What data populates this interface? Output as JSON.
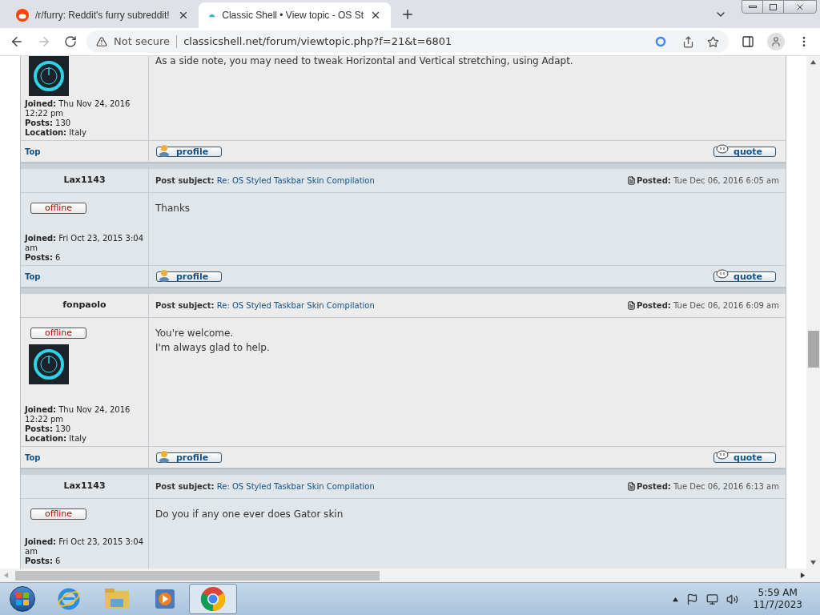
{
  "browser": {
    "tabs": [
      {
        "title": "/r/furry: Reddit's furry subreddit!",
        "selected": false
      },
      {
        "title": "Classic Shell • View topic - OS St",
        "selected": true
      }
    ],
    "security": "Not secure",
    "url": "classicshell.net/forum/viewtopic.php?f=21&t=6801"
  },
  "posts": [
    {
      "color": "#ececec",
      "avatar": true,
      "body": [
        "As a side note, you may need to tweak Horizontal and Vertical stretching, using Adapt."
      ],
      "profile": [
        {
          "label": "Joined:",
          "value": "Thu Nov 24, 2016 12:22 pm"
        },
        {
          "label": "Posts:",
          "value": "130"
        },
        {
          "label": "Location:",
          "value": "Italy"
        }
      ],
      "top": "Top",
      "profile_button": "profile",
      "quote_button": "quote"
    },
    {
      "color": "#e1e6ea",
      "author": "Lax1143",
      "subject_label": "Post subject:",
      "subject": "Re: OS Styled Taskbar Skin Compilation",
      "posted_label": "Posted:",
      "posted": "Tue Dec 06, 2016 6:05 am",
      "status": "offline",
      "avatar": false,
      "body": [
        "Thanks"
      ],
      "profile": [
        {
          "label": "Joined:",
          "value": "Fri Oct 23, 2015 3:04 am"
        },
        {
          "label": "Posts:",
          "value": "6"
        }
      ],
      "top": "Top",
      "profile_button": "profile",
      "quote_button": "quote"
    },
    {
      "color": "#ececec",
      "author": "fonpaolo",
      "subject_label": "Post subject:",
      "subject": "Re: OS Styled Taskbar Skin Compilation",
      "posted_label": "Posted:",
      "posted": "Tue Dec 06, 2016 6:09 am",
      "status": "offline",
      "avatar": true,
      "body": [
        "You're welcome.",
        "I'm always glad to help."
      ],
      "profile": [
        {
          "label": "Joined:",
          "value": "Thu Nov 24, 2016 12:22 pm"
        },
        {
          "label": "Posts:",
          "value": "130"
        },
        {
          "label": "Location:",
          "value": "Italy"
        }
      ],
      "top": "Top",
      "profile_button": "profile",
      "quote_button": "quote"
    },
    {
      "color": "#e1e6ea",
      "author": "Lax1143",
      "subject_label": "Post subject:",
      "subject": "Re: OS Styled Taskbar Skin Compilation",
      "posted_label": "Posted:",
      "posted": "Tue Dec 06, 2016 6:13 am",
      "status": "offline",
      "avatar": false,
      "body": [
        "Do you if any one ever does Gator skin"
      ],
      "profile": [
        {
          "label": "Joined:",
          "value": "Fri Oct 23, 2015 3:04 am"
        },
        {
          "label": "Posts:",
          "value": "6"
        }
      ]
    }
  ],
  "taskbar": {
    "apps": [
      {
        "kind": "ie",
        "selected": false
      },
      {
        "kind": "explorer",
        "selected": false
      },
      {
        "kind": "media",
        "selected": false
      },
      {
        "kind": "chrome",
        "selected": true
      }
    ],
    "time": "5:59 AM",
    "date": "11/7/2023"
  }
}
